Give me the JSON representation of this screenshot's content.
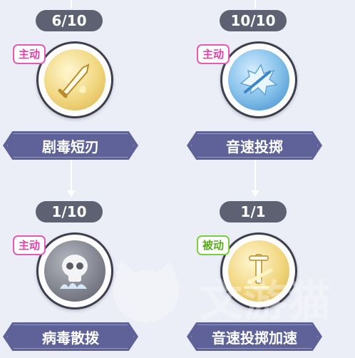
{
  "skills": [
    {
      "level": "6/10",
      "type": "主动",
      "name": "剧毒短刃",
      "icon": "poison-dagger-icon"
    },
    {
      "level": "10/10",
      "type": "主动",
      "name": "音速投掷",
      "icon": "sonic-throw-icon"
    },
    {
      "level": "1/10",
      "type": "主动",
      "name": "病毒散拨",
      "icon": "virus-spread-icon"
    },
    {
      "level": "1/1",
      "type": "被动",
      "name": "音速投掷加速",
      "icon": "sonic-throw-boost-icon"
    }
  ],
  "watermark": {
    "text": "文游猫",
    "icon": "cat-logo-icon"
  },
  "colors": {
    "active_tag": "#e45ab4",
    "passive_tag": "#7ccf3c",
    "banner": "#5f6299",
    "pill": "#5e6172"
  }
}
